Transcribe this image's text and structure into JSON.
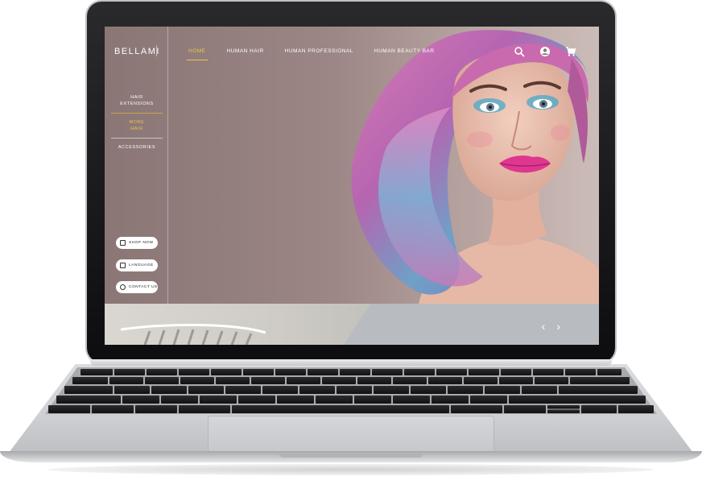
{
  "brand": {
    "name": "BELLAMI"
  },
  "topnav": {
    "items": [
      {
        "label": "HOME",
        "active": true
      },
      {
        "label": "HUMAN HAIR",
        "active": false
      },
      {
        "label": "HUMAN PROFESSIONAL",
        "active": false
      },
      {
        "label": "HUMAN BEAUTY BAR",
        "active": false
      }
    ],
    "icons": [
      "search-icon",
      "user-icon",
      "cart-icon"
    ]
  },
  "sidebar": {
    "items": [
      {
        "label_line1": "HAIR",
        "label_line2": "EXTENSIONS",
        "active": false
      },
      {
        "label_line1": "MORE",
        "label_line2": "HAIR",
        "active": true
      },
      {
        "label_line1": "ACCESSORIES",
        "label_line2": "",
        "active": false
      }
    ],
    "buttons": [
      {
        "label": "SHOP NOW",
        "icon": "bag-icon"
      },
      {
        "label": "LANGUAGE",
        "icon": "language-icon"
      },
      {
        "label": "CONTACT US",
        "icon": "headset-icon"
      }
    ]
  },
  "carousel": {
    "prev": "‹",
    "next": "›"
  },
  "colors": {
    "accent": "#e8c84a",
    "screen_bg": "#9b8585",
    "band": "#b8bcc1"
  }
}
